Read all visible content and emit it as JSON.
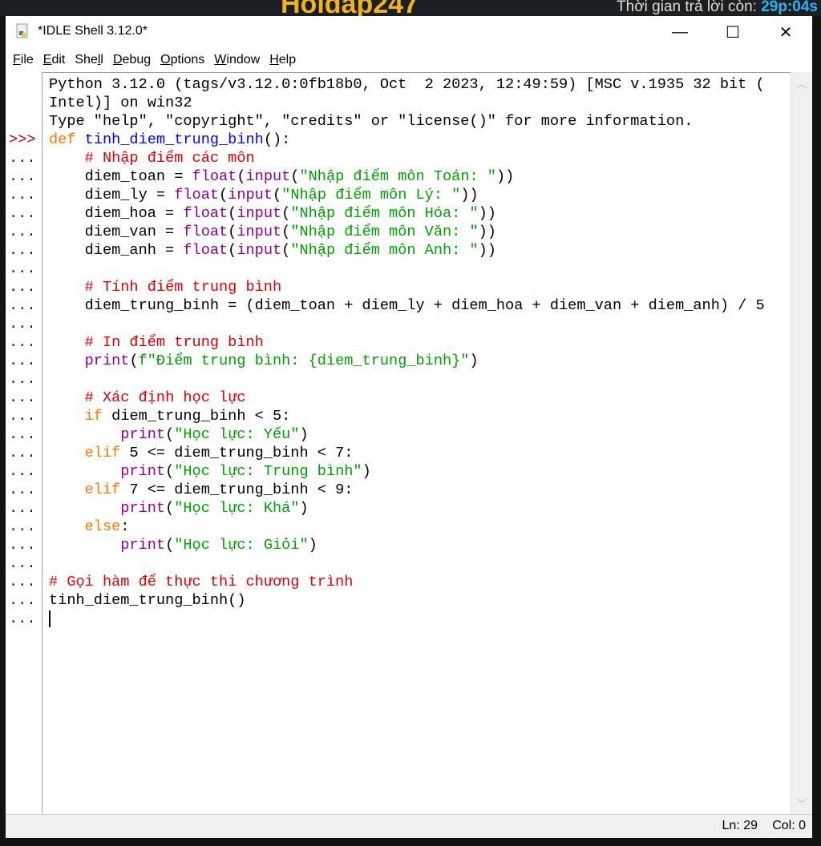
{
  "background": {
    "logo": "Hoidap247",
    "timer_label": "Thời gian trả lời còn:",
    "timer_value": "29p:04s"
  },
  "window": {
    "title": "*IDLE Shell 3.12.0*",
    "minimize": "—",
    "maximize": "☐",
    "close": "✕"
  },
  "menu": [
    {
      "key": "F",
      "rest": "ile"
    },
    {
      "key": "E",
      "rest": "dit"
    },
    {
      "pre": "She",
      "key": "l",
      "rest": "l"
    },
    {
      "key": "D",
      "rest": "ebug"
    },
    {
      "key": "O",
      "rest": "ptions"
    },
    {
      "key": "W",
      "rest": "indow"
    },
    {
      "key": "H",
      "rest": "elp"
    }
  ],
  "colors": {
    "keyword": "#ff7700",
    "definition": "#0000ff",
    "builtin": "#900090",
    "string": "#00a000",
    "comment": "#dd0000"
  },
  "lines": [
    {
      "p": "",
      "s": [
        [
          "plain",
          "Python 3.12.0 (tags/v3.12.0:0fb18b0, Oct  2 2023, 12:49:59) [MSC v.1935 32 bit ("
        ]
      ]
    },
    {
      "p": "",
      "s": [
        [
          "plain",
          "Intel)] on win32"
        ]
      ]
    },
    {
      "p": "",
      "s": [
        [
          "plain",
          "Type \"help\", \"copyright\", \"credits\" or \"license()\" for more information."
        ]
      ]
    },
    {
      "p": ">>>",
      "s": [
        [
          "kw",
          "def "
        ],
        [
          "def",
          "tinh_diem_trung_binh"
        ],
        [
          "plain",
          "():"
        ]
      ]
    },
    {
      "p": "...",
      "s": [
        [
          "plain",
          "    "
        ],
        [
          "cm",
          "# Nhập điểm các môn"
        ]
      ]
    },
    {
      "p": "...",
      "s": [
        [
          "plain",
          "    diem_toan = "
        ],
        [
          "bi",
          "float"
        ],
        [
          "plain",
          "("
        ],
        [
          "bi",
          "input"
        ],
        [
          "plain",
          "("
        ],
        [
          "str",
          "\"Nhập điểm môn Toán: \""
        ],
        [
          "plain",
          "))"
        ]
      ]
    },
    {
      "p": "...",
      "s": [
        [
          "plain",
          "    diem_ly = "
        ],
        [
          "bi",
          "float"
        ],
        [
          "plain",
          "("
        ],
        [
          "bi",
          "input"
        ],
        [
          "plain",
          "("
        ],
        [
          "str",
          "\"Nhập điểm môn Lý: \""
        ],
        [
          "plain",
          "))"
        ]
      ]
    },
    {
      "p": "...",
      "s": [
        [
          "plain",
          "    diem_hoa = "
        ],
        [
          "bi",
          "float"
        ],
        [
          "plain",
          "("
        ],
        [
          "bi",
          "input"
        ],
        [
          "plain",
          "("
        ],
        [
          "str",
          "\"Nhập điểm môn Hóa: \""
        ],
        [
          "plain",
          "))"
        ]
      ]
    },
    {
      "p": "...",
      "s": [
        [
          "plain",
          "    diem_van = "
        ],
        [
          "bi",
          "float"
        ],
        [
          "plain",
          "("
        ],
        [
          "bi",
          "input"
        ],
        [
          "plain",
          "("
        ],
        [
          "str",
          "\"Nhập điểm môn Văn: \""
        ],
        [
          "plain",
          "))"
        ]
      ]
    },
    {
      "p": "...",
      "s": [
        [
          "plain",
          "    diem_anh = "
        ],
        [
          "bi",
          "float"
        ],
        [
          "plain",
          "("
        ],
        [
          "bi",
          "input"
        ],
        [
          "plain",
          "("
        ],
        [
          "str",
          "\"Nhập điểm môn Anh: \""
        ],
        [
          "plain",
          "))"
        ]
      ]
    },
    {
      "p": "...",
      "s": []
    },
    {
      "p": "...",
      "s": [
        [
          "plain",
          "    "
        ],
        [
          "cm",
          "# Tính điểm trung bình"
        ]
      ]
    },
    {
      "p": "...",
      "s": [
        [
          "plain",
          "    diem_trung_binh = (diem_toan + diem_ly + diem_hoa + diem_van + diem_anh) / 5"
        ]
      ]
    },
    {
      "p": "...",
      "s": []
    },
    {
      "p": "...",
      "s": [
        [
          "plain",
          "    "
        ],
        [
          "cm",
          "# In điểm trung bình"
        ]
      ]
    },
    {
      "p": "...",
      "s": [
        [
          "plain",
          "    "
        ],
        [
          "bi",
          "print"
        ],
        [
          "plain",
          "("
        ],
        [
          "str",
          "f\"Điểm trung bình: {diem_trung_binh}\""
        ],
        [
          "plain",
          ")"
        ]
      ]
    },
    {
      "p": "...",
      "s": []
    },
    {
      "p": "...",
      "s": [
        [
          "plain",
          "    "
        ],
        [
          "cm",
          "# Xác định học lực"
        ]
      ]
    },
    {
      "p": "...",
      "s": [
        [
          "plain",
          "    "
        ],
        [
          "kw",
          "if"
        ],
        [
          "plain",
          " diem_trung_binh < 5:"
        ]
      ]
    },
    {
      "p": "...",
      "s": [
        [
          "plain",
          "        "
        ],
        [
          "bi",
          "print"
        ],
        [
          "plain",
          "("
        ],
        [
          "str",
          "\"Học lực: Yếu\""
        ],
        [
          "plain",
          ")"
        ]
      ]
    },
    {
      "p": "...",
      "s": [
        [
          "plain",
          "    "
        ],
        [
          "kw",
          "elif"
        ],
        [
          "plain",
          " 5 <= diem_trung_binh < 7:"
        ]
      ]
    },
    {
      "p": "...",
      "s": [
        [
          "plain",
          "        "
        ],
        [
          "bi",
          "print"
        ],
        [
          "plain",
          "("
        ],
        [
          "str",
          "\"Học lực: Trung bình\""
        ],
        [
          "plain",
          ")"
        ]
      ]
    },
    {
      "p": "...",
      "s": [
        [
          "plain",
          "    "
        ],
        [
          "kw",
          "elif"
        ],
        [
          "plain",
          " 7 <= diem_trung_binh < 9:"
        ]
      ]
    },
    {
      "p": "...",
      "s": [
        [
          "plain",
          "        "
        ],
        [
          "bi",
          "print"
        ],
        [
          "plain",
          "("
        ],
        [
          "str",
          "\"Học lực: Khá\""
        ],
        [
          "plain",
          ")"
        ]
      ]
    },
    {
      "p": "...",
      "s": [
        [
          "plain",
          "    "
        ],
        [
          "kw",
          "else"
        ],
        [
          "plain",
          ":"
        ]
      ]
    },
    {
      "p": "...",
      "s": [
        [
          "plain",
          "        "
        ],
        [
          "bi",
          "print"
        ],
        [
          "plain",
          "("
        ],
        [
          "str",
          "\"Học lực: Giỏi\""
        ],
        [
          "plain",
          ")"
        ]
      ]
    },
    {
      "p": "...",
      "s": []
    },
    {
      "p": "...",
      "s": [
        [
          "cm",
          "# Gọi hàm để thực thi chương trình"
        ]
      ]
    },
    {
      "p": "...",
      "s": [
        [
          "plain",
          "tinh_diem_trung_binh()"
        ]
      ]
    },
    {
      "p": "...",
      "s": []
    }
  ],
  "status": {
    "line": "Ln: 29",
    "col": "Col: 0"
  }
}
